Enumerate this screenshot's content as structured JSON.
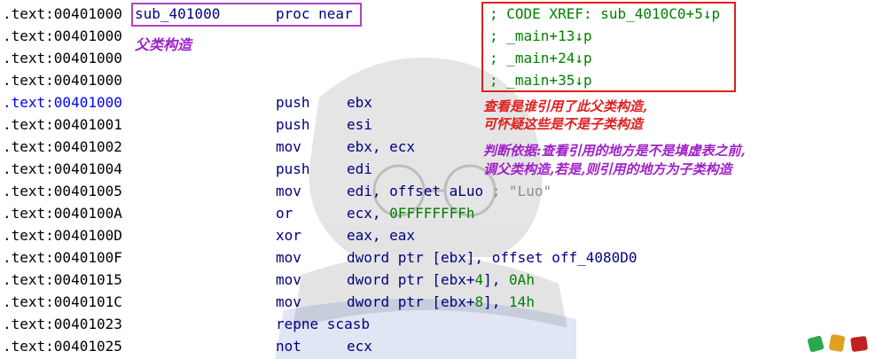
{
  "listing": [
    {
      "addr": ".text:00401000",
      "label": "sub_401000",
      "proc": "proc near"
    },
    {
      "addr": ".text:00401000"
    },
    {
      "addr": ".text:00401000"
    },
    {
      "addr": ".text:00401000"
    },
    {
      "addr": ".text:00401000",
      "highlight": true,
      "mnem": "push",
      "op": "ebx"
    },
    {
      "addr": ".text:00401001",
      "mnem": "push",
      "op": "esi"
    },
    {
      "addr": ".text:00401002",
      "mnem": "mov",
      "op": "ebx, ecx"
    },
    {
      "addr": ".text:00401004",
      "mnem": "push",
      "op": "edi"
    },
    {
      "addr": ".text:00401005",
      "mnem": "mov",
      "op": "edi, offset aLuo",
      "comment": " ; \"Luo\""
    },
    {
      "addr": ".text:0040100A",
      "mnem": "or",
      "op": "ecx, ",
      "op_num": "0FFFFFFFFh"
    },
    {
      "addr": ".text:0040100D",
      "mnem": "xor",
      "op": "eax, eax"
    },
    {
      "addr": ".text:0040100F",
      "mnem": "mov",
      "op": "dword ptr [ebx], offset off_4080D0"
    },
    {
      "addr": ".text:00401015",
      "mnem": "mov",
      "op": "dword ptr [ebx+",
      "op_num_mid": "4",
      "op_tail": "], ",
      "op_num": "0Ah"
    },
    {
      "addr": ".text:0040101C",
      "mnem": "mov",
      "op": "dword ptr [ebx+",
      "op_num_mid": "8",
      "op_tail": "], ",
      "op_num": "14h"
    },
    {
      "addr": ".text:00401023",
      "mnem": "repne scasb",
      "op": ""
    },
    {
      "addr": ".text:00401025",
      "mnem": "not",
      "op": "ecx"
    }
  ],
  "xrefs": [
    "; CODE XREF: sub_4010C0+5↓p",
    "; _main+13↓p",
    "; _main+24↓p",
    "; _main+35↓p"
  ],
  "annotations": {
    "parent_ctor": "父类构造",
    "red_line1": "查看是谁引用了此父类构造,",
    "red_line2": "可怀疑这些是不是子类构造",
    "purple_line1": "判断依据:查看引用的地方是不是填虚表之前,",
    "purple_line2": "调父类构造,若是,则引用的地方为子类构造"
  },
  "colors": {
    "address": "#000000",
    "address_highlight": "#0000ff",
    "instruction": "#000080",
    "number": "#008000",
    "comment": "#8c8c8c",
    "xref": "#008000",
    "box_purple": "#b040c8",
    "box_red": "#e02020"
  }
}
